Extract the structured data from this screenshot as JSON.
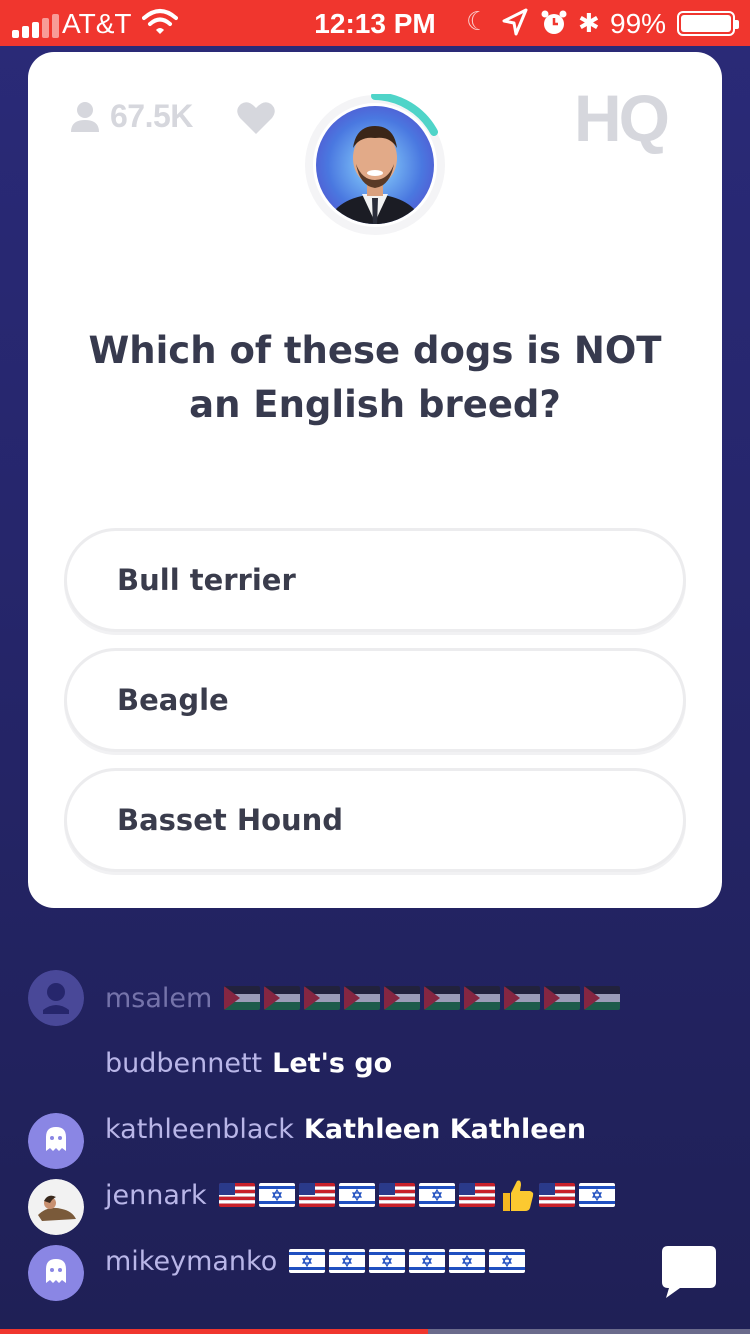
{
  "status_bar": {
    "carrier": "AT&T",
    "time": "12:13 PM",
    "battery_percent": "99%",
    "battery_level": 0.99
  },
  "card": {
    "viewer_count": "67.5K",
    "logo_text": "HQ",
    "question": "Which of these dogs is NOT an English breed?",
    "answers": [
      "Bull terrier",
      "Beagle",
      "Basset Hound"
    ]
  },
  "chat": {
    "messages": [
      {
        "user": "msalem",
        "text": "",
        "emoji": "flag-jordan",
        "count": 10,
        "avatar": "default-avatar"
      },
      {
        "user": "budbennett",
        "text": "Let's go",
        "avatar": "none"
      },
      {
        "user": "kathleenblack",
        "text": "Kathleen Kathleen",
        "avatar": "ghost-avatar"
      },
      {
        "user": "jennark",
        "text": "",
        "emoji": "flags-us-israel-thumbs-up",
        "avatar": "photo-avatar"
      },
      {
        "user": "mikeymanko",
        "text": "",
        "emoji": "flag-israel",
        "count": 6,
        "avatar": "ghost-avatar"
      }
    ]
  },
  "colors": {
    "status_bar": "#f0362e",
    "background": "#2a2a78",
    "username": "#b9b6e8",
    "card_muted": "#d6d7dd",
    "question_text": "#373a4e"
  },
  "video_progress": 0.57
}
